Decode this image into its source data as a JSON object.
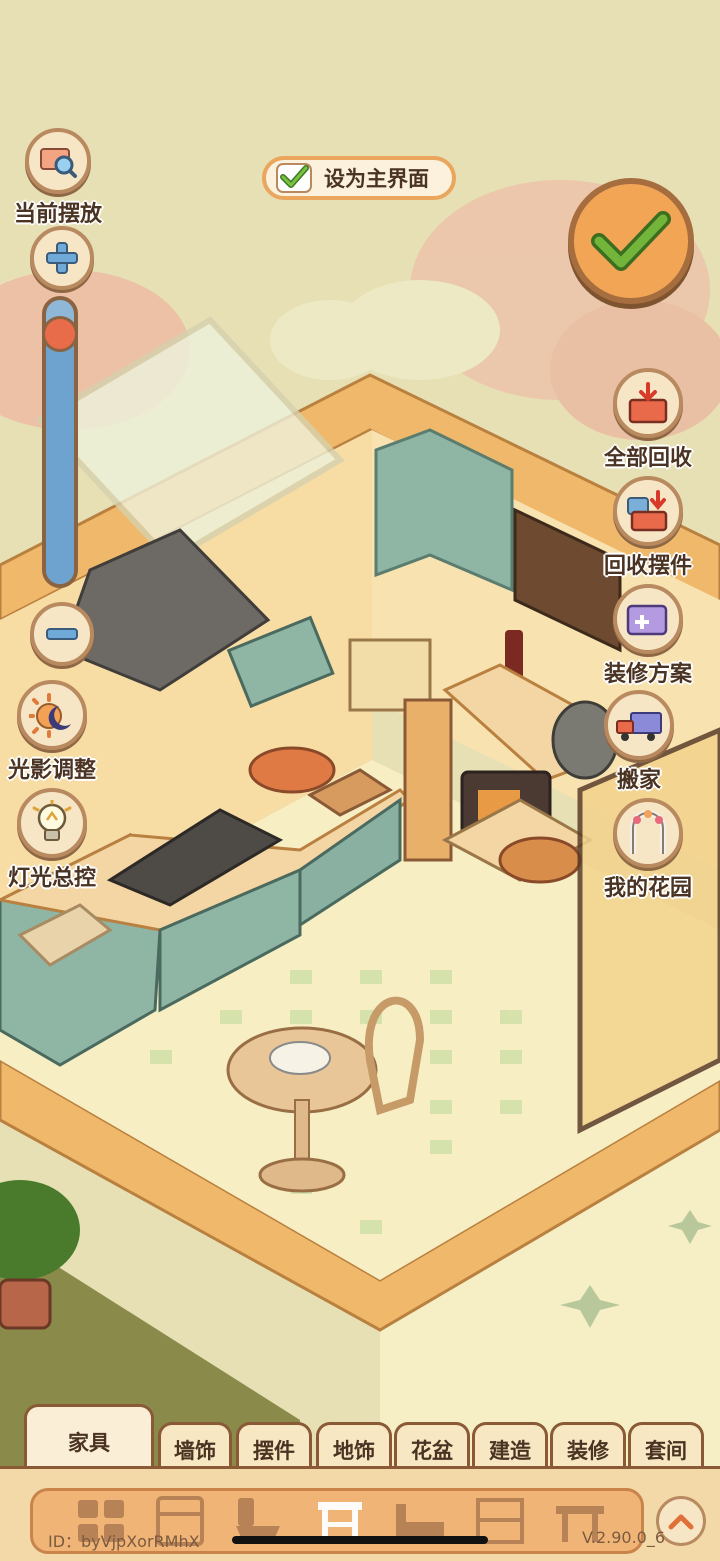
{
  "top_bar": {
    "set_home_label": "设为主界面",
    "set_home_checked": true
  },
  "left_panel": {
    "current_placement_label": "当前摆放",
    "zoom_level": 0.92,
    "lighting_adjust_label": "光影调整",
    "light_control_label": "灯光总控"
  },
  "right_panel": {
    "recycle_all_label": "全部回收",
    "recycle_decor_label": "回收摆件",
    "decor_plan_label": "装修方案",
    "move_label": "搬家",
    "my_garden_label": "我的花园"
  },
  "tabs": [
    {
      "label": "家具",
      "active": true
    },
    {
      "label": "墙饰",
      "active": false
    },
    {
      "label": "摆件",
      "active": false
    },
    {
      "label": "地饰",
      "active": false
    },
    {
      "label": "花盆",
      "active": false
    },
    {
      "label": "建造",
      "active": false
    },
    {
      "label": "装修",
      "active": false
    },
    {
      "label": "套间",
      "active": false
    }
  ],
  "categories": [
    "all-icon",
    "cabinet-icon",
    "toilet-icon",
    "table-icon",
    "bed-icon",
    "shelf-icon",
    "bench-icon"
  ],
  "footer": {
    "player_id": "ID：byVjpXorRMhX",
    "version": "V.2.90.0_6"
  },
  "colors": {
    "accent_orange": "#f2a655",
    "check_green": "#6fb53a",
    "cabinet_teal": "#8fb5a5",
    "wall_cream": "#f7dca4",
    "floor_cream": "#f7eec4"
  }
}
